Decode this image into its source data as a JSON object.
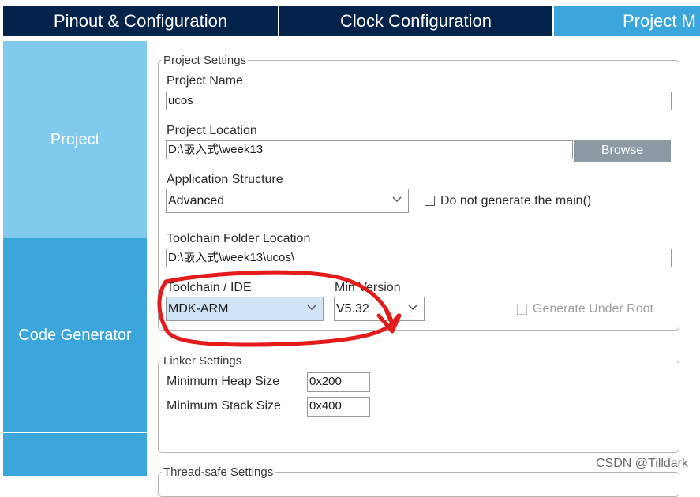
{
  "tabs": [
    {
      "label": "Pinout & Configuration"
    },
    {
      "label": "Clock Configuration"
    },
    {
      "label": "Project M"
    }
  ],
  "sidebar": {
    "items": [
      {
        "label": "Project"
      },
      {
        "label": "Code Generator"
      },
      {
        "label": ""
      }
    ]
  },
  "project_settings": {
    "legend": "Project Settings",
    "project_name_label": "Project Name",
    "project_name_value": "ucos",
    "project_location_label": "Project Location",
    "project_location_value": "D:\\嵌入式\\week13",
    "browse_label": "Browse",
    "app_structure_label": "Application Structure",
    "app_structure_value": "Advanced",
    "no_main_label": "Do not generate the main()",
    "no_main_checked": false,
    "toolchain_folder_label": "Toolchain Folder Location",
    "toolchain_folder_value": "D:\\嵌入式\\week13\\ucos\\",
    "toolchain_label": "Toolchain / IDE",
    "toolchain_value": "MDK-ARM",
    "min_version_label": "Min Version",
    "min_version_value": "V5.32",
    "generate_under_root_label": "Generate Under Root",
    "generate_under_root_checked": false
  },
  "linker_settings": {
    "legend": "Linker Settings",
    "heap_label": "Minimum Heap Size",
    "heap_value": "0x200",
    "stack_label": "Minimum Stack Size",
    "stack_value": "0x400"
  },
  "thread_safe": {
    "legend": "Thread-safe Settings"
  },
  "watermark": "CSDN @Tilldark",
  "colors": {
    "tab_dark": "#03234b",
    "tab_active": "#3ba6dc",
    "sidebar_light": "#7fcaed",
    "sidebar_mid": "#3ba6dc",
    "browse_button": "#8d9aa3",
    "annotation_red": "#e31b1b",
    "toolchain_highlight": "#cfe4f5"
  },
  "annotation": {
    "type": "red freehand circle with arrow around Toolchain / IDE and Min Version"
  }
}
